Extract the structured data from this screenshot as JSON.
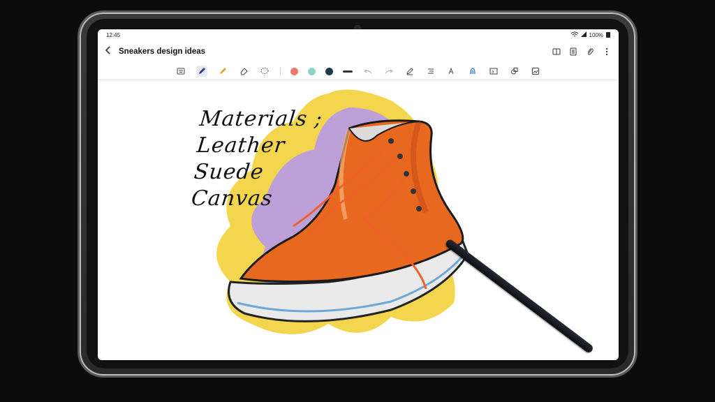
{
  "status": {
    "time": "12:45",
    "battery": "100%"
  },
  "header": {
    "back_icon": "chevron-left-icon",
    "title": "Sneakers design ideas",
    "actions": [
      "book-view-icon",
      "page-icon",
      "attach-icon",
      "more-vert-icon"
    ]
  },
  "toolbar": {
    "tools": [
      "keyboard-icon",
      "pen-icon",
      "highlighter-icon",
      "eraser-icon",
      "lasso-icon"
    ],
    "colors": [
      "#f07a6a",
      "#8fd3c5",
      "#1e3a4a"
    ],
    "actions": [
      "undo-icon",
      "redo-icon",
      "pen-settings-icon",
      "shape-icon",
      "text-icon",
      "sound-icon",
      "image-icon",
      "stylus-icon",
      "insert-icon"
    ]
  },
  "note": {
    "handwriting": [
      "Materials ;",
      "Leather",
      "Suede",
      "Canvas"
    ]
  },
  "colors": {
    "sneaker": "#e8681f",
    "splash_yellow": "#f2d23a",
    "splash_purple": "#b89ae8"
  }
}
